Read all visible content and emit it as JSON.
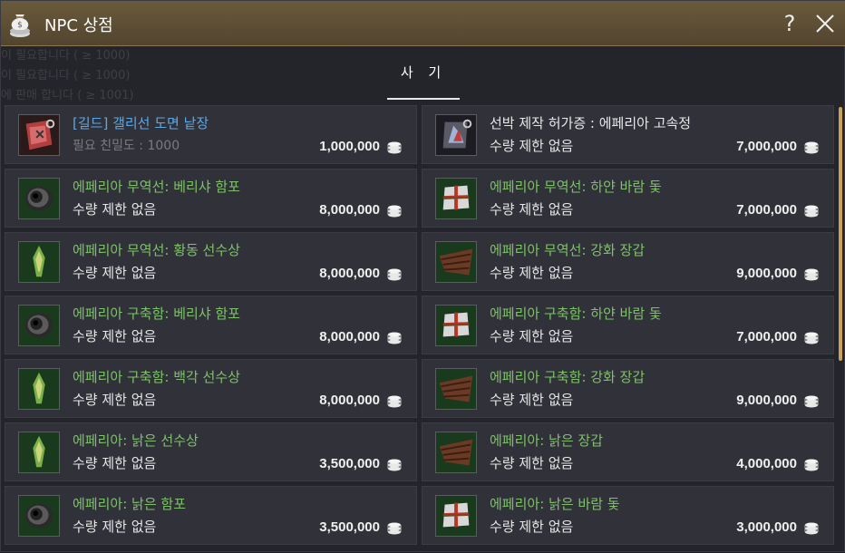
{
  "window": {
    "title": "NPC 상점"
  },
  "tabs": {
    "buy_label": "사 기"
  },
  "background_text": [
    "이 필요합니다 ( ≥ 1000)",
    "이 필요합니다 ( ≥ 1000)",
    "에 판매 합니다 ( ≥ 1001)"
  ],
  "items": [
    {
      "name": "[길드] 갤리선 도면 낱장",
      "sub": "필요 친밀도 : 1000",
      "price": "1,000,000",
      "icon": "scroll-icon"
    },
    {
      "name": "선박 제작 허가증 : 에페리아 고속정",
      "sub": "수량 제한 없음",
      "price": "7,000,000",
      "icon": "ship-permit-icon"
    },
    {
      "name": "에페리아 무역선: 베리샤 함포",
      "sub": "수량 제한 없음",
      "price": "8,000,000",
      "icon": "cannon-icon"
    },
    {
      "name": "에페리아 무역선: 하얀 바람 돛",
      "sub": "수량 제한 없음",
      "price": "7,000,000",
      "icon": "sail-icon"
    },
    {
      "name": "에페리아 무역선: 황동 선수상",
      "sub": "수량 제한 없음",
      "price": "8,000,000",
      "icon": "figurehead-icon"
    },
    {
      "name": "에페리아 무역선: 강화 장갑",
      "sub": "수량 제한 없음",
      "price": "9,000,000",
      "icon": "armor-icon"
    },
    {
      "name": "에페리아 구축함: 베리샤 함포",
      "sub": "수량 제한 없음",
      "price": "8,000,000",
      "icon": "cannon-icon"
    },
    {
      "name": "에페리아 구축함: 하얀 바람 돛",
      "sub": "수량 제한 없음",
      "price": "7,000,000",
      "icon": "sail-icon"
    },
    {
      "name": "에페리아 구축함: 백각 선수상",
      "sub": "수량 제한 없음",
      "price": "8,000,000",
      "icon": "figurehead-icon"
    },
    {
      "name": "에페리아 구축함: 강화 장갑",
      "sub": "수량 제한 없음",
      "price": "9,000,000",
      "icon": "armor-icon"
    },
    {
      "name": "에페리아: 낡은 선수상",
      "sub": "수량 제한 없음",
      "price": "3,500,000",
      "icon": "figurehead-icon"
    },
    {
      "name": "에페리아: 낡은 장갑",
      "sub": "수량 제한 없음",
      "price": "4,000,000",
      "icon": "armor-icon"
    },
    {
      "name": "에페리아: 낡은 함포",
      "sub": "수량 제한 없음",
      "price": "3,500,000",
      "icon": "cannon-icon"
    },
    {
      "name": "에페리아: 낡은 바람 돛",
      "sub": "수량 제한 없음",
      "price": "3,000,000",
      "icon": "sail-icon"
    }
  ]
}
